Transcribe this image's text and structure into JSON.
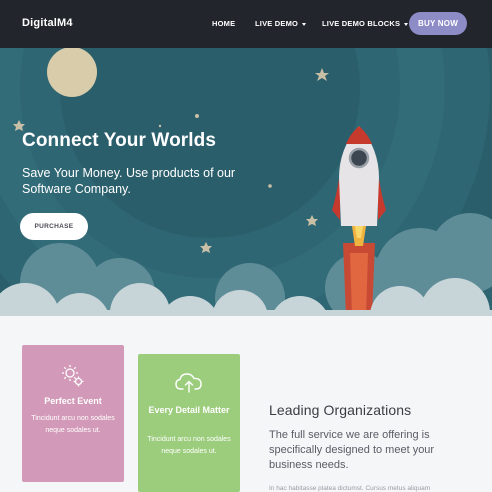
{
  "navbar": {
    "brand": "DigitalM4",
    "links": [
      {
        "label": "HOME"
      },
      {
        "label": "LIVE DEMO"
      },
      {
        "label": "LIVE DEMO BLOCKS"
      }
    ],
    "cta_label": "BUY NOW"
  },
  "hero": {
    "title": "Connect Your Worlds",
    "subtitle": "Save Your Money. Use products of our Software Company.",
    "button_label": "PURCHASE"
  },
  "features": [
    {
      "title": "Perfect Event",
      "text": "Tincidunt arcu non sodales neque sodales ut.",
      "icon": "gears-icon",
      "color": "#d29ab8"
    },
    {
      "title": "Every Detail Matter",
      "text": "Tincidunt arcu non sodales neque sodales ut.",
      "icon": "cloud-upload-icon",
      "color": "#9ccd7d"
    }
  ],
  "lead": {
    "title": "Leading Organizations",
    "text": "The full service we are offering is specifically designed to meet your business needs.",
    "small": "In hac habitasse platea dictumst. Cursus metus aliquam"
  },
  "colors": {
    "navbar": "#23252c",
    "cta": "#8d8cc7",
    "hero_bg": "#2a5f6c",
    "page_bg": "#f5f6f8"
  }
}
